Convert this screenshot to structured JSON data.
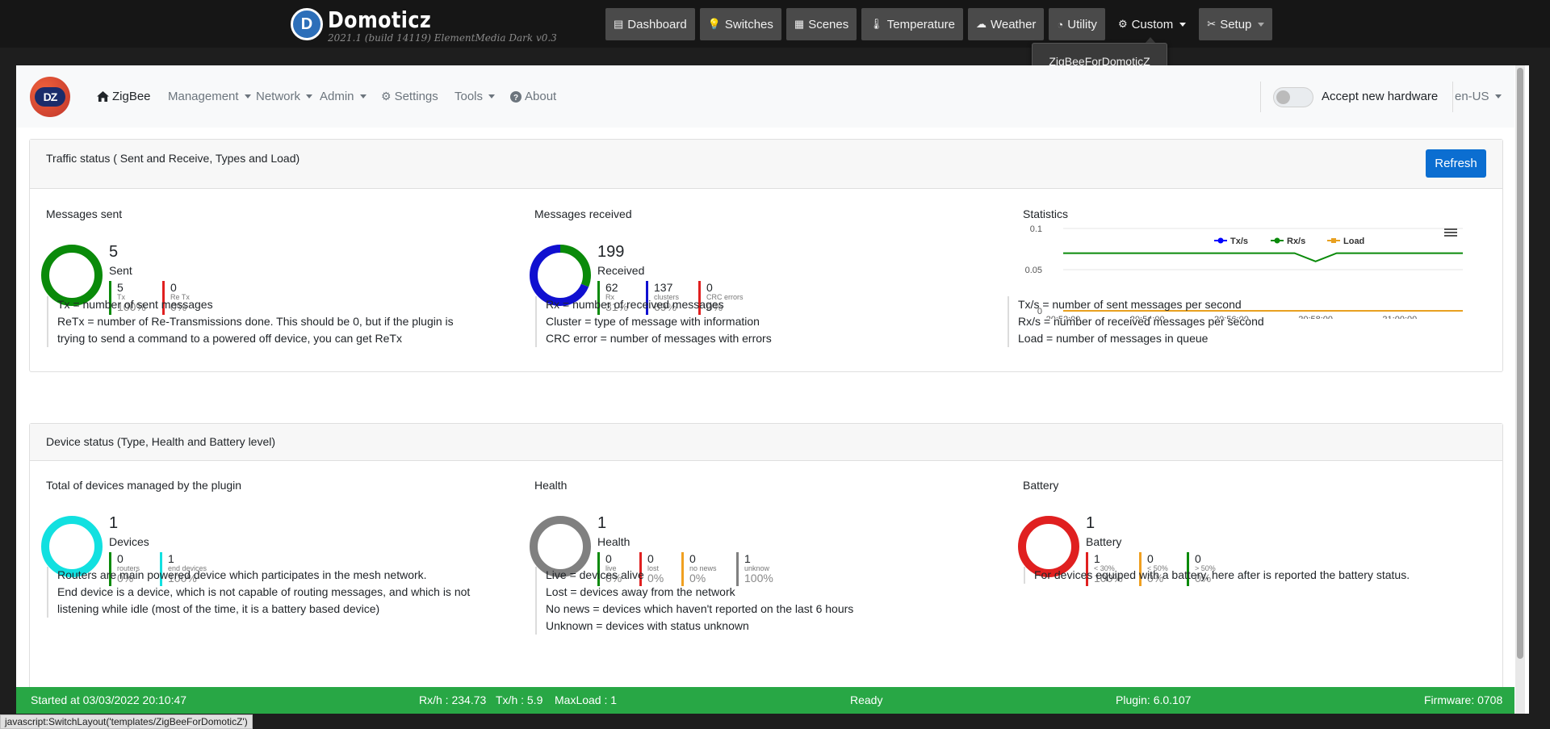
{
  "app": {
    "name": "Domoticz",
    "subtitle": "2021.1 (build 14119) ElementMedia Dark v0.3",
    "nav": [
      {
        "label": "Dashboard",
        "icon": "dashboard-icon"
      },
      {
        "label": "Switches",
        "icon": "lightbulb-icon"
      },
      {
        "label": "Scenes",
        "icon": "scenes-icon"
      },
      {
        "label": "Temperature",
        "icon": "thermometer-icon"
      },
      {
        "label": "Weather",
        "icon": "weather-icon"
      },
      {
        "label": "Utility",
        "icon": "utility-icon"
      },
      {
        "label": "Custom",
        "icon": "gear-icon",
        "active": true
      },
      {
        "label": "Setup",
        "icon": "tools-icon"
      }
    ],
    "custom_menu": [
      "ZigBeeForDomoticZ"
    ]
  },
  "plugin_nav": {
    "logo": "DZ",
    "items": [
      "ZigBee",
      "Management",
      "Network",
      "Admin",
      "Settings",
      "Tools",
      "About"
    ],
    "accept_hardware": "Accept new hardware",
    "language": "en-US"
  },
  "traffic": {
    "title": "Traffic status ( Sent and Receive, Types and Load)",
    "refresh": "Refresh",
    "sent": {
      "title": "Messages sent",
      "total": "5",
      "caption": "Sent",
      "stats": [
        {
          "value": "5",
          "label": "Tx",
          "pct": "100%",
          "color": "#0a8a0a"
        },
        {
          "value": "0",
          "label": "Re Tx",
          "pct": "0%",
          "color": "#e02020"
        }
      ],
      "desc": [
        "Tx = number of sent messages",
        "ReTx = number of Re-Transmissions done. This should be 0, but if the plugin is",
        "trying to send a command to a powered off device, you can get ReTx"
      ]
    },
    "received": {
      "title": "Messages received",
      "total": "199",
      "caption": "Received",
      "stats": [
        {
          "value": "62",
          "label": "Rx",
          "pct": "31%",
          "color": "#0a8a0a"
        },
        {
          "value": "137",
          "label": "clusters",
          "pct": "69%",
          "color": "#1010d0"
        },
        {
          "value": "0",
          "label": "CRC errors",
          "pct": "0%",
          "color": "#e02020"
        }
      ],
      "desc": [
        "Rx = number of received messages",
        "Cluster = type of message with information",
        "CRC error = number of messages with errors"
      ]
    },
    "statistics": {
      "title": "Statistics",
      "desc": [
        "Tx/s = number of sent messages per second",
        "Rx/s = number of received messages per second",
        "Load = number of messages in queue"
      ]
    }
  },
  "devices": {
    "title": "Device status (Type, Health and Battery level)",
    "total": {
      "title": "Total of devices managed by the plugin",
      "total": "1",
      "caption": "Devices",
      "stats": [
        {
          "value": "0",
          "label": "routers",
          "pct": "0%",
          "color": "#0a8a0a"
        },
        {
          "value": "1",
          "label": "end devices",
          "pct": "100%",
          "color": "#12e0e0"
        }
      ],
      "desc": [
        "Routers are main powered device which participates in the mesh network.",
        "End device is a device, which is not capable of routing messages, and which is not",
        "listening while idle (most of the time, it is a battery based device)"
      ]
    },
    "health": {
      "title": "Health",
      "total": "1",
      "caption": "Health",
      "stats": [
        {
          "value": "0",
          "label": "live",
          "pct": "0%",
          "color": "#0a8a0a"
        },
        {
          "value": "0",
          "label": "lost",
          "pct": "0%",
          "color": "#e02020"
        },
        {
          "value": "0",
          "label": "no news",
          "pct": "0%",
          "color": "#f0a020"
        },
        {
          "value": "1",
          "label": "unknow",
          "pct": "100%",
          "color": "#808080"
        }
      ],
      "desc": [
        "Live = devices alive",
        "Lost = devices away from the network",
        "No news = devices which haven't reported on the last 6 hours",
        "Unknown = devices with status unknown"
      ]
    },
    "battery": {
      "title": "Battery",
      "total": "1",
      "caption": "Battery",
      "stats": [
        {
          "value": "1",
          "label": "< 30%",
          "pct": "100%",
          "color": "#e02020"
        },
        {
          "value": "0",
          "label": "< 50%",
          "pct": "0%",
          "color": "#f0a020"
        },
        {
          "value": "0",
          "label": "> 50%",
          "pct": "0%",
          "color": "#0a8a0a"
        }
      ],
      "desc": [
        "For devices equiped with a battery, here after is reported the battery status."
      ]
    }
  },
  "status_bar": {
    "started": "Started at 03/03/2022 20:10:47",
    "rx": "Rx/h : 234.73",
    "tx": "Tx/h : 5.9",
    "maxload": "MaxLoad : 1",
    "state": "Ready",
    "plugin": "Plugin: 6.0.107",
    "firmware": "Firmware: 0708"
  },
  "url_tooltip": "javascript:SwitchLayout('templates/ZigBeeForDomoticZ')",
  "chart_data": {
    "type": "line",
    "x": [
      "20:52:00",
      "20:53:00",
      "20:54:00",
      "20:55:00",
      "20:56:00",
      "20:57:00",
      "20:57:30",
      "20:58:00",
      "20:58:30",
      "20:59:00",
      "21:00:00",
      "21:01:00",
      "21:01:30"
    ],
    "x_ticks": [
      "20:52:00",
      "20:54:00",
      "20:56:00",
      "20:58:00",
      "21:00:00"
    ],
    "ylim": [
      0,
      0.1
    ],
    "y_ticks": [
      "0",
      "0.05",
      "0.1"
    ],
    "legend_position": "top-center",
    "series": [
      {
        "name": "Tx/s",
        "color": "#0000ff",
        "values": [
          0,
          0,
          0,
          0,
          0,
          0,
          0,
          0,
          0,
          0,
          0,
          0,
          0
        ]
      },
      {
        "name": "Rx/s",
        "color": "#0a8a0a",
        "values": [
          0.07,
          0.07,
          0.07,
          0.07,
          0.07,
          0.07,
          0.07,
          0.06,
          0.07,
          0.07,
          0.07,
          0.07,
          0.07
        ]
      },
      {
        "name": "Load",
        "color": "#e8a020",
        "values": [
          0,
          0,
          0,
          0,
          0,
          0,
          0,
          0,
          0,
          0,
          0,
          0,
          0
        ]
      }
    ]
  }
}
